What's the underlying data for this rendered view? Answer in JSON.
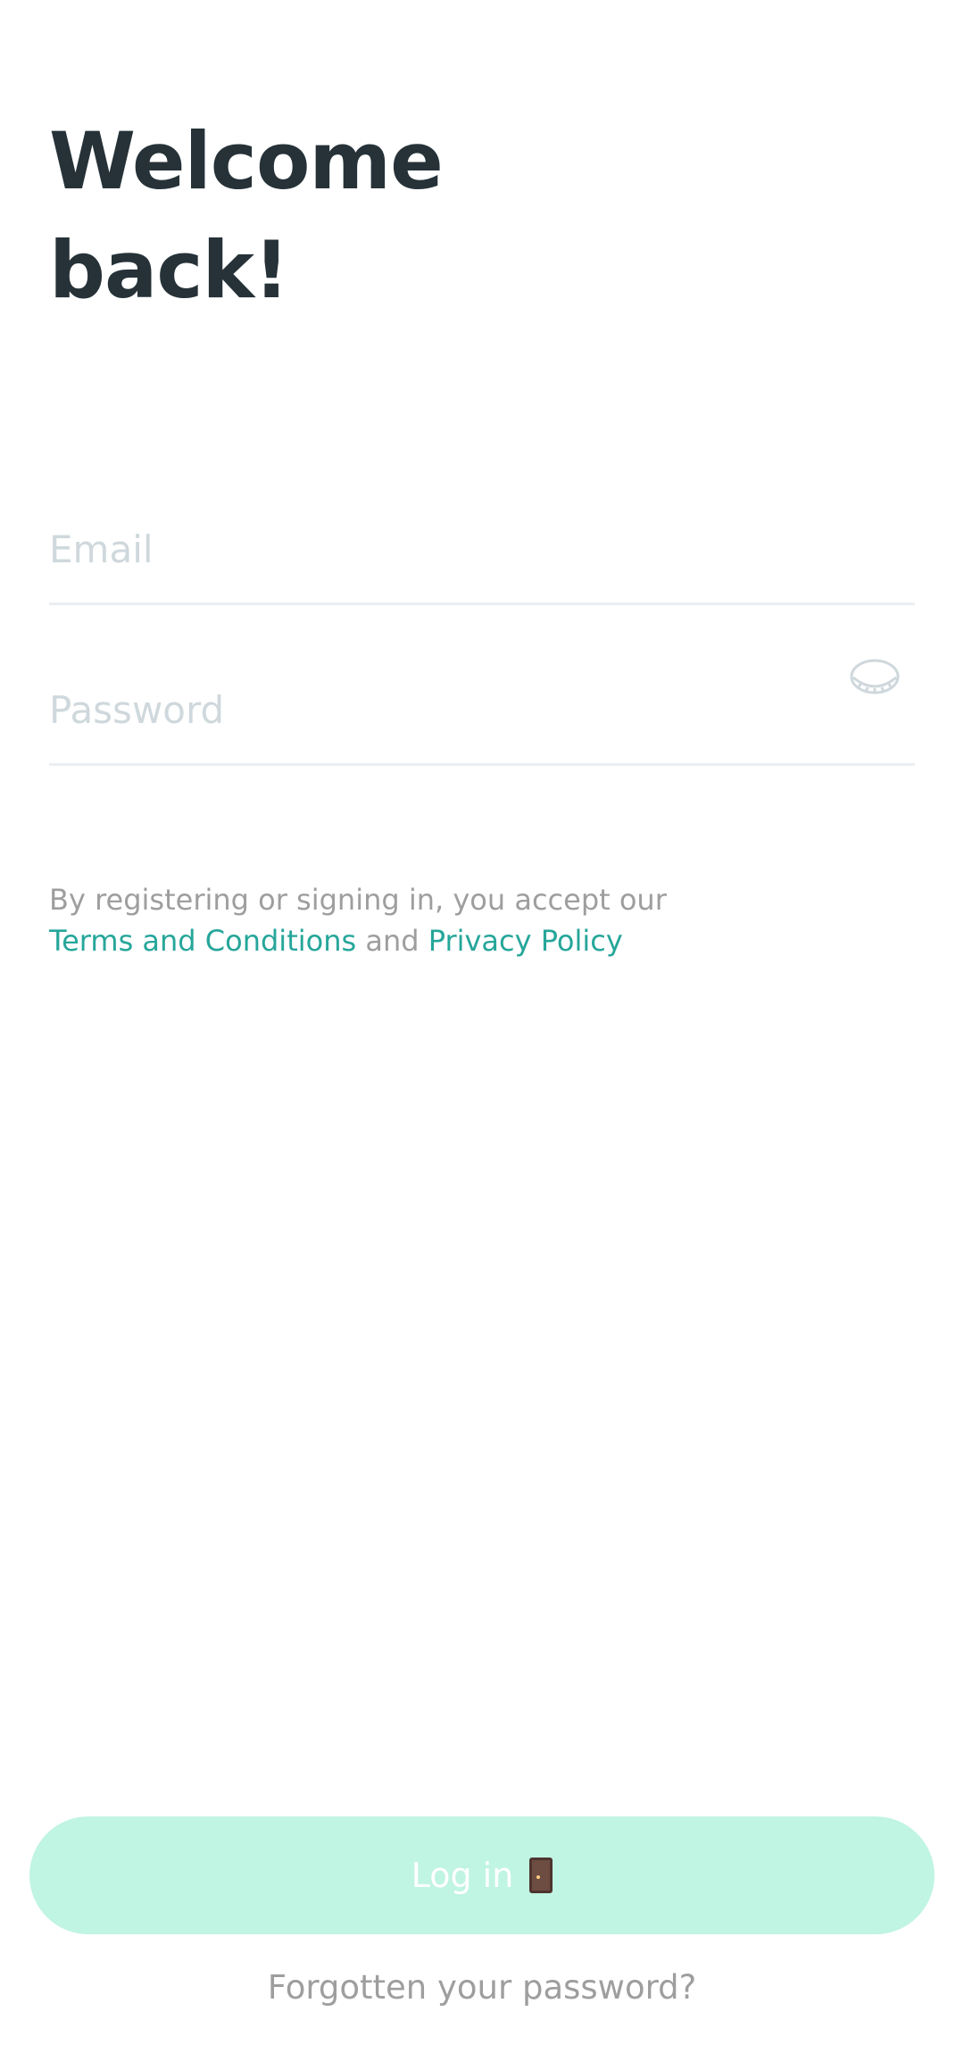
{
  "header": {
    "title_line1": "Welcome",
    "title_line2": "back!"
  },
  "form": {
    "email": {
      "value": "",
      "placeholder": "Email"
    },
    "password": {
      "value": "",
      "placeholder": "Password"
    }
  },
  "legal": {
    "prefix": "By registering or signing in, you accept our",
    "terms_label": "Terms and Conditions",
    "conjunction": "and",
    "privacy_label": "Privacy Policy"
  },
  "actions": {
    "login_label": "Log in",
    "login_icon": "door-icon",
    "forgot_label": "Forgotten your password?"
  },
  "colors": {
    "title": "#263238",
    "link": "#26a69a",
    "muted": "#9e9e9e",
    "button_bg": "#c0f4e3",
    "divider": "#eceff1"
  }
}
